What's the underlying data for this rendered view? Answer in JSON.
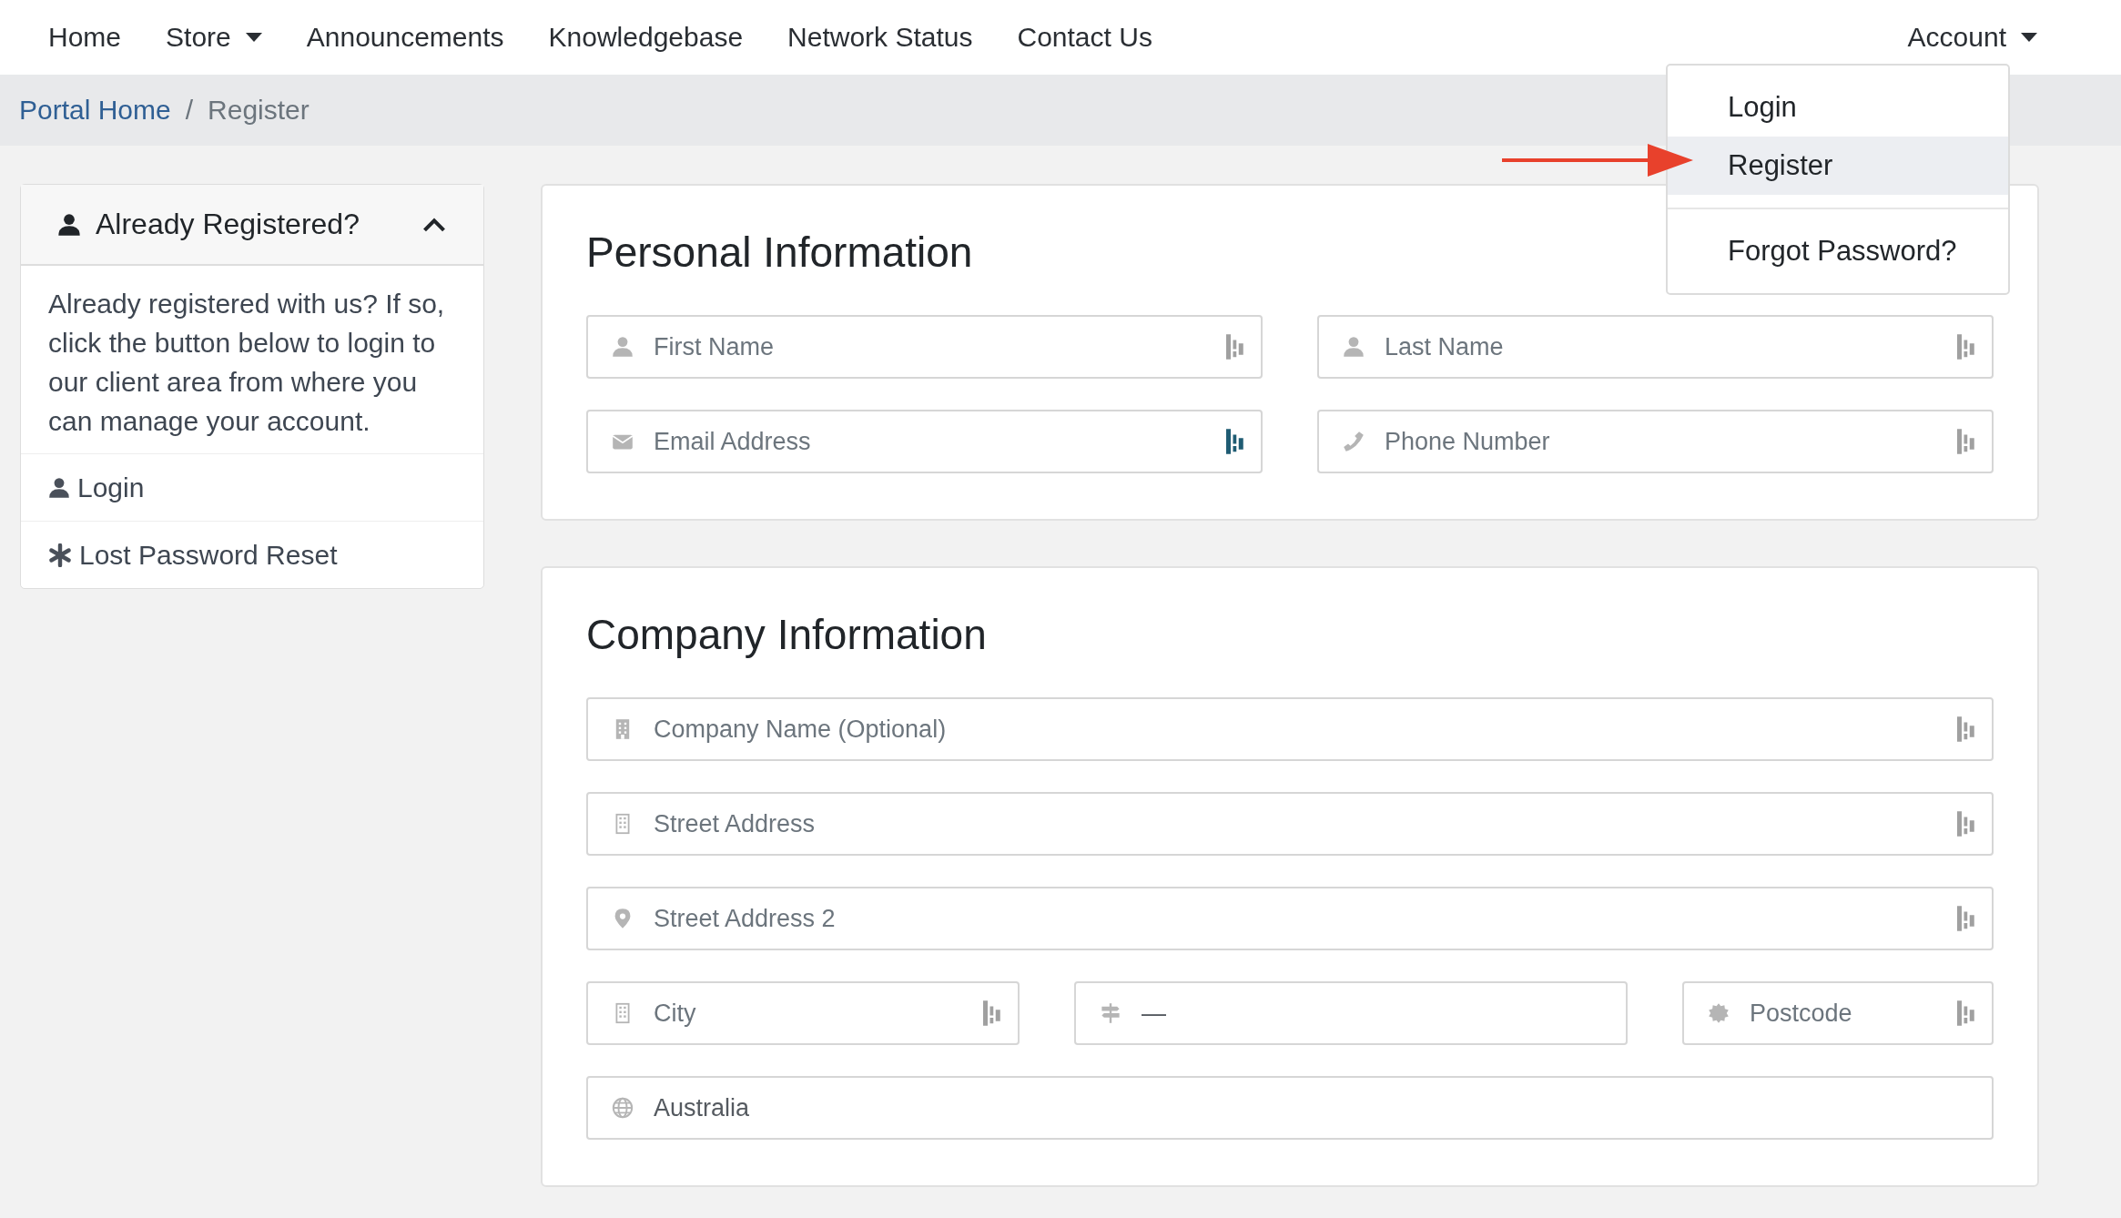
{
  "nav": {
    "items": [
      {
        "label": "Home",
        "dropdown": false
      },
      {
        "label": "Store",
        "dropdown": true
      },
      {
        "label": "Announcements",
        "dropdown": false
      },
      {
        "label": "Knowledgebase",
        "dropdown": false
      },
      {
        "label": "Network Status",
        "dropdown": false
      },
      {
        "label": "Contact Us",
        "dropdown": false
      }
    ],
    "account": {
      "label": "Account",
      "dropdown": true
    }
  },
  "breadcrumb": [
    {
      "label": "Portal Home",
      "link": true
    },
    {
      "label": "Register",
      "link": false
    }
  ],
  "breadcrumb_separator": "/",
  "account_menu": {
    "items": [
      {
        "label": "Login",
        "selected": false,
        "divider_before": false
      },
      {
        "label": "Register",
        "selected": true,
        "divider_before": false
      },
      {
        "label": "Forgot Password?",
        "selected": false,
        "divider_before": true
      }
    ]
  },
  "sidebar": {
    "title": "Already Registered?",
    "expanded": true,
    "text": "Already registered with us? If so, click the button below to login to our client area from where you can manage your account.",
    "links": [
      {
        "label": "Login",
        "kind": "login"
      },
      {
        "label": "Lost Password Reset",
        "kind": "reset"
      }
    ]
  },
  "sections": [
    {
      "title": "Personal Information",
      "rows": [
        [
          {
            "kind": "name",
            "placeholder": "First Name",
            "autofill_icon": true,
            "autofill_active": false
          },
          {
            "kind": "name",
            "placeholder": "Last Name",
            "autofill_icon": true,
            "autofill_active": false
          }
        ],
        [
          {
            "kind": "email",
            "placeholder": "Email Address",
            "autofill_icon": true,
            "autofill_active": true
          },
          {
            "kind": "phone",
            "placeholder": "Phone Number",
            "autofill_icon": true,
            "autofill_active": false
          }
        ]
      ]
    },
    {
      "title": "Company Information",
      "rows": [
        [
          {
            "kind": "company",
            "placeholder": "Company Name (Optional)",
            "autofill_icon": true,
            "autofill_active": false
          }
        ],
        [
          {
            "kind": "address",
            "placeholder": "Street Address",
            "autofill_icon": true,
            "autofill_active": false
          }
        ],
        [
          {
            "kind": "location",
            "placeholder": "Street Address 2",
            "autofill_icon": true,
            "autofill_active": false
          }
        ],
        [
          {
            "kind": "city",
            "placeholder": "City",
            "autofill_icon": true,
            "autofill_active": false
          },
          {
            "kind": "state",
            "value": "—",
            "autofill_icon": false
          },
          {
            "kind": "postcode",
            "placeholder": "Postcode",
            "autofill_icon": true,
            "autofill_active": false
          }
        ],
        [
          {
            "kind": "country",
            "value": "Australia",
            "autofill_icon": false
          }
        ]
      ]
    }
  ]
}
